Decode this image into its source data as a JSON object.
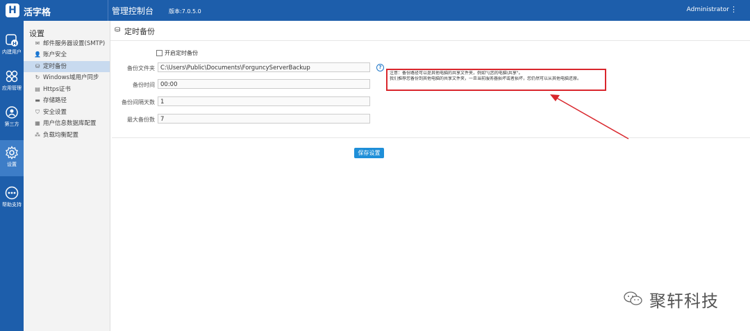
{
  "header": {
    "logo_letter": "H",
    "app_name": "活字格",
    "console_title": "管理控制台",
    "version": "版本:7.0.5.0",
    "user": "Administrator",
    "menu_icon": "kebab-menu-icon"
  },
  "leftnav": [
    {
      "label": "内建用户",
      "icon": "builtin-user-icon"
    },
    {
      "label": "应用管理",
      "icon": "app-grid-icon"
    },
    {
      "label": "第三方",
      "icon": "third-party-icon"
    },
    {
      "label": "设置",
      "icon": "gear-icon"
    },
    {
      "label": "帮助支持",
      "icon": "more-dots-icon"
    }
  ],
  "sidebar": {
    "title": "设置",
    "items": [
      {
        "label": "邮件服务器设置(SMTP)",
        "icon": "envelope-icon"
      },
      {
        "label": "账户安全",
        "icon": "user-icon"
      },
      {
        "label": "定时备份",
        "icon": "backup-icon"
      },
      {
        "label": "Windows域用户同步",
        "icon": "refresh-icon"
      },
      {
        "label": "Https证书",
        "icon": "certificate-icon"
      },
      {
        "label": "存储路径",
        "icon": "folder-icon"
      },
      {
        "label": "安全设置",
        "icon": "shield-icon"
      },
      {
        "label": "用户信息数据库配置",
        "icon": "database-icon"
      },
      {
        "label": "负载均衡配置",
        "icon": "network-icon"
      }
    ]
  },
  "page": {
    "title": "定时备份",
    "enable_checkbox_label": "开启定时备份",
    "fields": [
      {
        "label": "备份文件夹",
        "value": "C:\\Users\\Public\\Documents\\ForguncyServerBackup"
      },
      {
        "label": "备份时间",
        "value": "00:00"
      },
      {
        "label": "备份间隔天数",
        "value": "1"
      },
      {
        "label": "最大备份数",
        "value": "7"
      }
    ],
    "note_line1": "注意：备份路径可以是其他电脑的共享文件夹，例如\"\\\\您的电脑\\共享\"。",
    "note_line2": "我们推荐您备份到其他电脑的共享文件夹，一旦当前服务器损坏或者损坏，您仍然可以从其他电脑还原。",
    "save_label": "保存设置"
  },
  "watermark": "聚轩科技",
  "colors": {
    "primary": "#1d5eab",
    "highlight": "#d9262c",
    "button": "#1f8fd8"
  }
}
